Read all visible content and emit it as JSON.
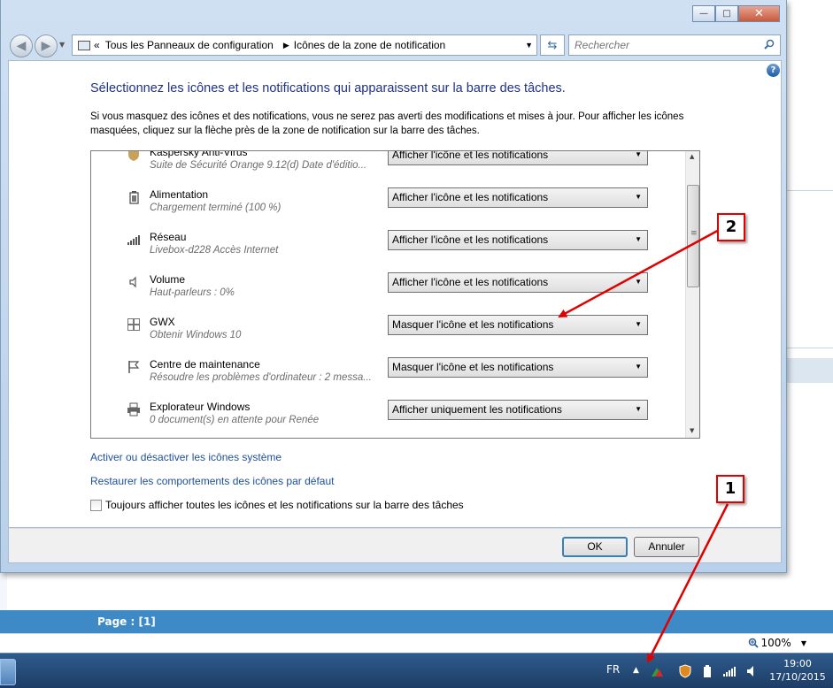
{
  "window": {
    "minimize": "—",
    "maximize": "□",
    "close": "✕"
  },
  "nav": {
    "breadcrumb_prefix": "«",
    "breadcrumb": [
      "Tous les Panneaux de configuration",
      "Icônes de la zone de notification"
    ],
    "search_placeholder": "Rechercher"
  },
  "content": {
    "heading": "Sélectionnez les icônes et les notifications qui apparaissent sur la barre des tâches.",
    "description": "Si vous masquez des icônes et des notifications, vous ne serez pas averti des modifications et mises à jour. Pour afficher les icônes masquées, cliquez sur la flèche près de la zone de notification sur la barre des tâches.",
    "rows": [
      {
        "icon": "shield-icon",
        "name": "Kaspersky Anti-Virus",
        "sub": "Suite de Sécurité Orange 9.12(d) Date d'éditio...",
        "value": "Afficher l'icône et les notifications"
      },
      {
        "icon": "battery-icon",
        "name": "Alimentation",
        "sub": "Chargement terminé (100 %)",
        "value": "Afficher l'icône et les notifications"
      },
      {
        "icon": "network-icon",
        "name": "Réseau",
        "sub": "Livebox-d228 Accès Internet",
        "value": "Afficher l'icône et les notifications"
      },
      {
        "icon": "speaker-icon",
        "name": "Volume",
        "sub": "Haut-parleurs : 0%",
        "value": "Afficher l'icône et les notifications"
      },
      {
        "icon": "windows-icon",
        "name": "GWX",
        "sub": "Obtenir Windows 10",
        "value": "Masquer l'icône et les notifications"
      },
      {
        "icon": "flag-icon",
        "name": "Centre de maintenance",
        "sub": "Résoudre les problèmes d'ordinateur : 2 messa...",
        "value": "Masquer l'icône et les notifications"
      },
      {
        "icon": "printer-icon",
        "name": "Explorateur Windows",
        "sub": "0 document(s) en attente pour Renée",
        "value": "Afficher uniquement les notifications"
      }
    ],
    "link_system_icons": "Activer ou désactiver les icônes système",
    "link_restore": "Restaurer les comportements des icônes par défaut",
    "always_show_label": "Toujours afficher toutes les icônes et les notifications sur la barre des tâches",
    "always_show_checked": false
  },
  "buttons": {
    "ok": "OK",
    "cancel": "Annuler"
  },
  "background": {
    "page_label": "Page : [1]",
    "zoom": "100%"
  },
  "taskbar": {
    "language": "FR",
    "time": "19:00",
    "date": "17/10/2015"
  },
  "annotations": {
    "badge1": "1",
    "badge2": "2",
    "arrow_color": "#e00000"
  }
}
